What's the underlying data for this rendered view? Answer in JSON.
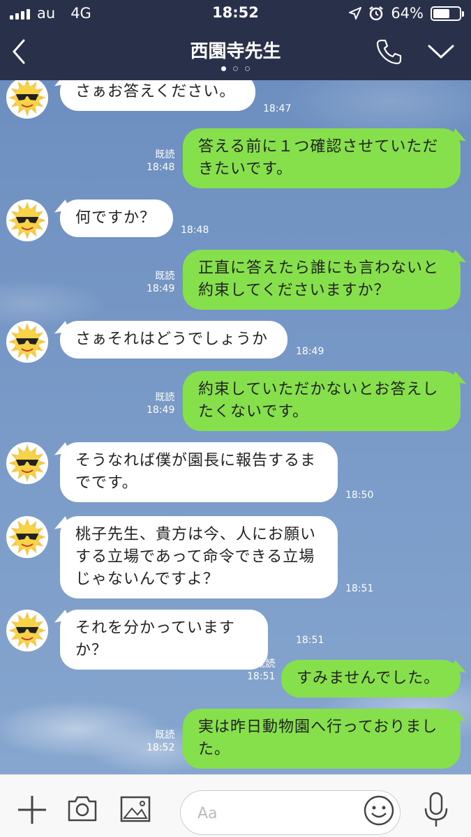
{
  "status_bar": {
    "carrier": "au",
    "network": "4G",
    "time": "18:52",
    "battery": "64%",
    "battery_level": 0.64
  },
  "header": {
    "title": "西園寺先生",
    "page_dots": 3,
    "active_dot": 0
  },
  "colors": {
    "header_bg": "#28304a",
    "incoming_bubble": "#ffffff",
    "outgoing_bubble": "#86e04b",
    "chat_bg": "#7ea0c9"
  },
  "messages": [
    {
      "dir": "in",
      "lines": [
        "さぁお答えください。"
      ],
      "time": "18:47"
    },
    {
      "dir": "out",
      "lines": [
        "答える前に１つ確認させていただ",
        "きたいです。"
      ],
      "read": "既読",
      "time": "18:48"
    },
    {
      "dir": "in",
      "lines": [
        "何ですか？"
      ],
      "time": "18:48"
    },
    {
      "dir": "out",
      "lines": [
        "正直に答えたら誰にも言わないと",
        "約束してくださいますか？"
      ],
      "read": "既読",
      "time": "18:49"
    },
    {
      "dir": "in",
      "lines": [
        "さぁそれはどうでしょうか"
      ],
      "time": "18:49"
    },
    {
      "dir": "out",
      "lines": [
        "約束していただかないとお答えし",
        "たくないです。"
      ],
      "read": "既読",
      "time": "18:49"
    },
    {
      "dir": "in",
      "lines": [
        "そうなれば僕が園長に報告するま",
        "でです。"
      ],
      "time": "18:50"
    },
    {
      "dir": "in",
      "lines": [
        "桃子先生、貴方は今、人にお願い",
        "する立場であって命令できる立場",
        "じゃないんですよ？"
      ],
      "time": "18:51"
    },
    {
      "dir": "in",
      "lines": [
        "それを分かっていますか？"
      ],
      "time": "18:51"
    },
    {
      "dir": "out",
      "lines": [
        "すみませんでした。"
      ],
      "read": "既読",
      "time": "18:51"
    },
    {
      "dir": "out",
      "lines": [
        "実は昨日動物園へ行っておりまし",
        "た。"
      ],
      "read": "既読",
      "time": "18:52"
    }
  ],
  "input": {
    "placeholder": "Aa"
  },
  "icons": {
    "back": "chevron-left-icon",
    "call": "phone-icon",
    "menu": "chevron-down-icon",
    "add": "plus-icon",
    "camera": "camera-icon",
    "image": "image-icon",
    "emoji": "smiley-icon",
    "mic": "microphone-icon",
    "avatar": "sun-with-sunglasses-avatar"
  }
}
